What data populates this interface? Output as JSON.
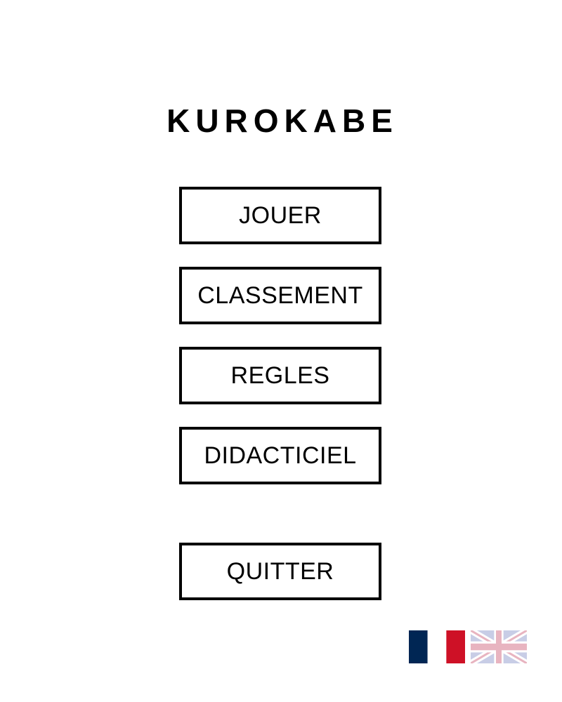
{
  "game": {
    "title": "KUROKABE"
  },
  "menu": {
    "play_label": "JOUER",
    "ranking_label": "CLASSEMENT",
    "rules_label": "REGLES",
    "tutorial_label": "DIDACTICIEL",
    "quit_label": "QUITTER"
  },
  "languages": [
    {
      "icon": "french-flag-icon",
      "colors": [
        "#002654",
        "#ffffff",
        "#ce1126"
      ]
    },
    {
      "icon": "uk-flag-icon",
      "colors": [
        "#c8cde6",
        "#ffffff",
        "#e8b4c0"
      ],
      "faded": true
    }
  ]
}
